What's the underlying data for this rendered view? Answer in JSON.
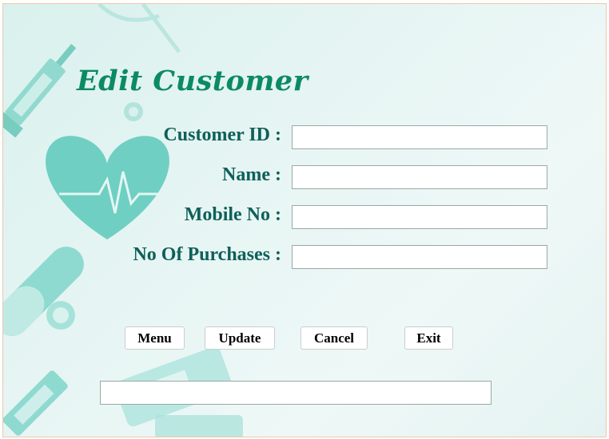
{
  "form": {
    "title": "Edit Customer",
    "fields": [
      {
        "label": "Customer ID :",
        "value": ""
      },
      {
        "label": "Name :",
        "value": ""
      },
      {
        "label": "Mobile No :",
        "value": ""
      },
      {
        "label": "No Of Purchases :",
        "value": ""
      }
    ],
    "buttons": {
      "menu": "Menu",
      "update": "Update",
      "cancel": "Cancel",
      "exit": "Exit"
    },
    "status_value": ""
  },
  "colors": {
    "title": "#0c8a63",
    "label": "#0f5f5a",
    "background": "#e6f5f3",
    "accent_teal": "#6fcfc2"
  },
  "decorations": [
    "syringe-icon",
    "heart-pulse-icon",
    "pill-capsule-icon",
    "stethoscope-icon",
    "medicine-bottle-icon"
  ]
}
